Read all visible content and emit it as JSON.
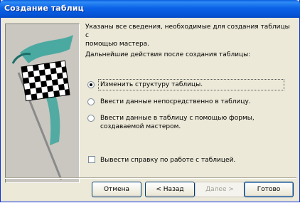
{
  "window": {
    "title": "Создание таблиц"
  },
  "info": {
    "line1": "Указаны все сведения, необходимые для создания таблицы с",
    "line2": "помощью мастера.",
    "question": "Дальнейшие действия после создания таблицы:"
  },
  "options": [
    {
      "label": "Изменить структуру таблицы.",
      "selected": true
    },
    {
      "label": "Ввести данные непосредственно в таблицу.",
      "selected": false
    },
    {
      "label_line1": "Ввести данные в таблицу с помощью формы,",
      "label_line2": "создаваемой мастером.",
      "selected": false
    }
  ],
  "help_checkbox": {
    "label": "Вывести справку по работе с таблицей.",
    "checked": false
  },
  "buttons": {
    "cancel": "Отмена",
    "back": "< Назад",
    "next": "Далее >",
    "finish": "Готово"
  },
  "colors": {
    "titlebar": "#0b62e6",
    "dialog_bg": "#ece9d8",
    "flag_swoosh": "#2aa198"
  }
}
